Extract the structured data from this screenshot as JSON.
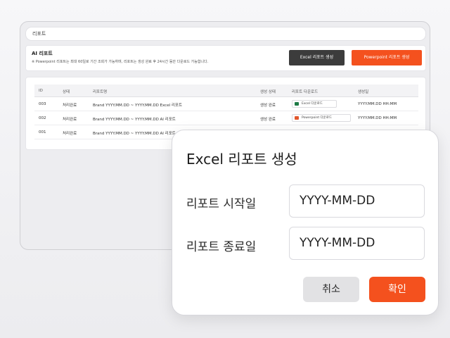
{
  "background_window": {
    "search_text": "리포트",
    "report_section": {
      "title": "AI 리포트",
      "description": "※ Powerpoint 리포트는 최대 60일로 기간 조회가 가능하며, 리포트는 생성 완료 후 24시간 동안 다운로드 가능합니다.",
      "excel_button": "Excel 리포트 생성",
      "ppt_button": "Powerpoint 리포트 생성"
    },
    "table": {
      "headers": [
        "ID",
        "상태",
        "리포트명",
        "생성 상태",
        "리포트 다운로드",
        "생성일"
      ],
      "rows": [
        {
          "id": "003",
          "status": "처리완료",
          "name": "Brand YYYY.MM.DD ~ YYYY.MM.DD Excel 리포트",
          "gen_status": "생성 완료",
          "download": "Excel 다운로드",
          "download_type": "excel",
          "date": "YYYY.MM.DD HH:MM"
        },
        {
          "id": "002",
          "status": "처리완료",
          "name": "Brand YYYY.MM.DD ~ YYYY.MM.DD AI 리포트",
          "gen_status": "생성 완료",
          "download": "Powerpoint 다운로드",
          "download_type": "ppt",
          "date": "YYYY.MM.DD HH:MM"
        },
        {
          "id": "001",
          "status": "처리완료",
          "name": "Brand YYYY.MM.DD ~ YYYY.MM.DD AI 리포트",
          "gen_status": "",
          "download": "",
          "download_type": "",
          "date": ""
        }
      ]
    }
  },
  "modal": {
    "title": "Excel 리포트 생성",
    "start_label": "리포트 시작일",
    "start_value": "YYYY-MM-DD",
    "end_label": "리포트 종료일",
    "end_value": "YYYY-MM-DD",
    "cancel_label": "취소",
    "confirm_label": "확인"
  },
  "colors": {
    "accent": "#f4511e",
    "dark_button": "#3c3c3c",
    "excel_icon": "#1d7a45",
    "ppt_icon": "#e2572c"
  }
}
